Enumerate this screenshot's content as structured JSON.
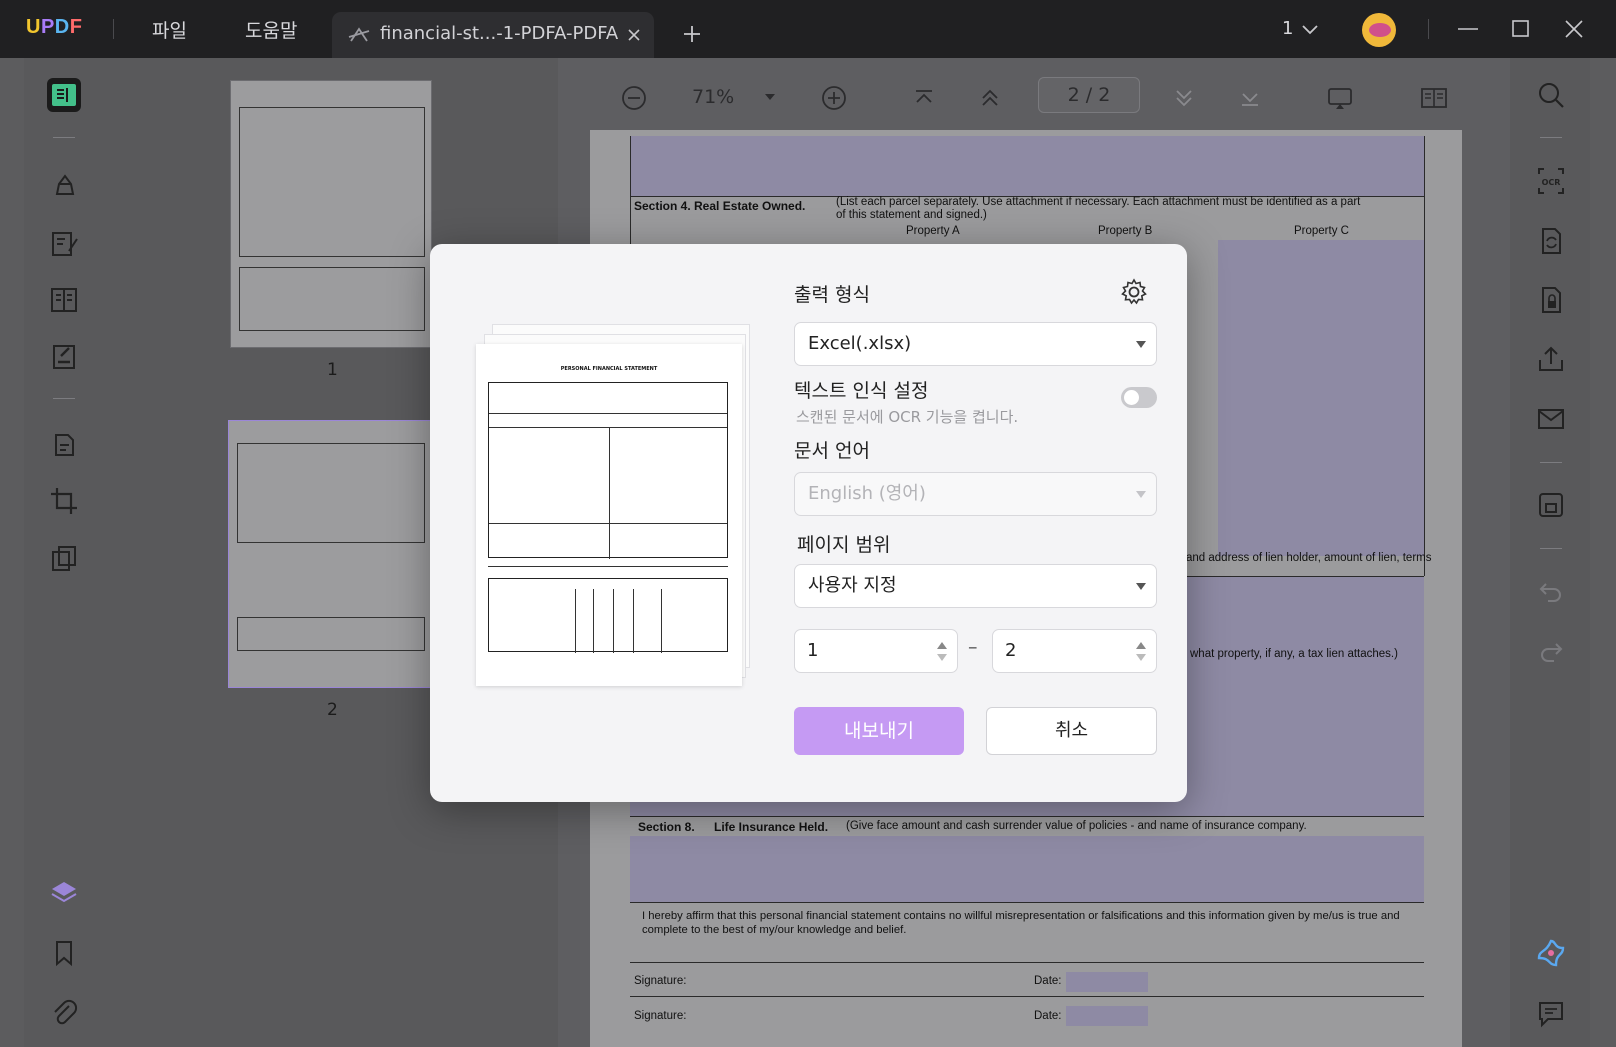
{
  "titlebar": {
    "brand": "UPDF",
    "menu_file": "파일",
    "menu_help": "도움말",
    "tab_title": "financial-st...-1-PDFA-PDFA",
    "window_count": "1"
  },
  "toolbar": {
    "zoom": "71%",
    "page_indicator": "2 / 2"
  },
  "thumbnails": [
    {
      "label": "1"
    },
    {
      "label": "2"
    }
  ],
  "document": {
    "section4_title": "Section 4.  Real Estate Owned.",
    "section4_note": "(List each parcel separately.  Use attachment if necessary.  Each attachment must be identified as a part",
    "section4_note2": "of this statement and signed.)",
    "property_a": "Property A",
    "property_b": "Property B",
    "property_c": "Property C",
    "lien_text": "and address of lien holder, amount of lien, terms",
    "tax_text": "what property, if any, a tax lien attaches.)",
    "section8_num": "Section 8.",
    "section8_title": "Life Insurance Held.",
    "section8_note": "(Give face amount and cash surrender value of policies - and name of insurance company.",
    "affirm_1": "I hereby affirm that this personal financial statement contains no willful misrepresentation or falsifications and this information given by me/us is true and",
    "affirm_2": "complete to the best of my/our knowledge and belief.",
    "signature_label": "Signature:",
    "date_label": "Date:"
  },
  "dialog": {
    "preview_title": "PERSONAL FINANCIAL STATEMENT",
    "output_format_label": "출력 형식",
    "output_format_value": "Excel(.xlsx)",
    "ocr_label": "텍스트 인식 설정",
    "ocr_hint": "스캔된 문서에 OCR 기능을 켭니다.",
    "ocr_enabled": false,
    "language_label": "문서 언어",
    "language_value": "English (영어)",
    "range_label": "페이지 범위",
    "range_value": "사용자 지정",
    "range_from": "1",
    "range_dash": "–",
    "range_to": "2",
    "export_button": "내보내기",
    "cancel_button": "취소"
  },
  "colors": {
    "accent": "#c59af3",
    "titlebar_bg": "#202022"
  }
}
